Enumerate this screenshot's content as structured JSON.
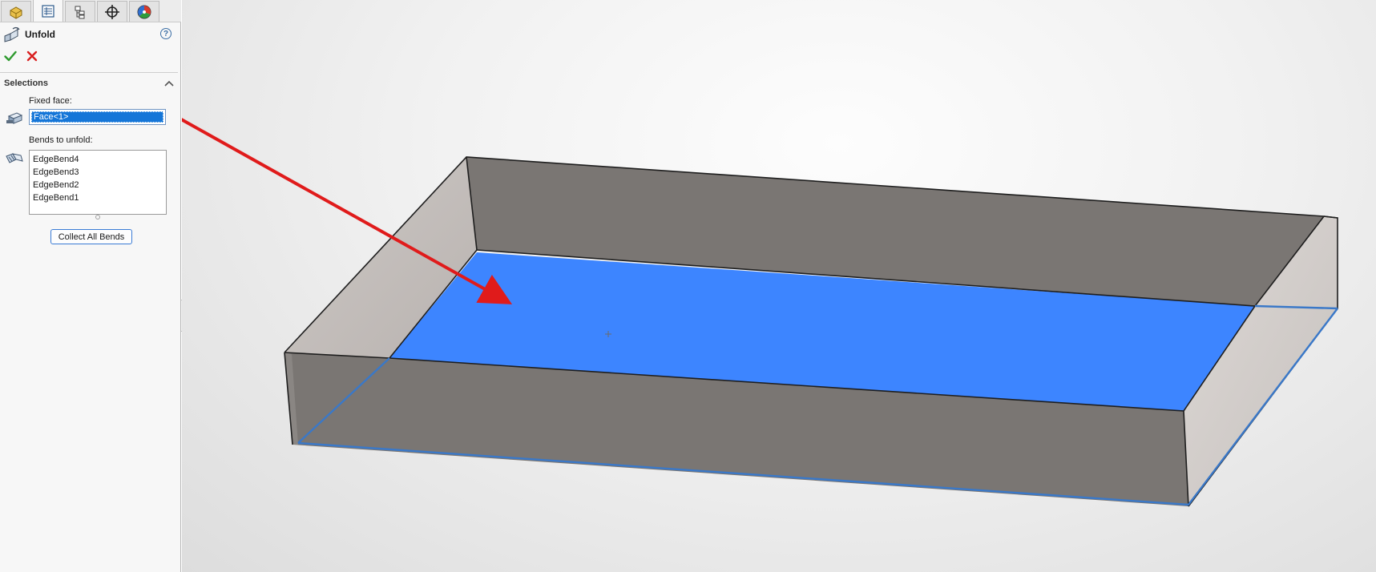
{
  "panel": {
    "tabs": [
      {
        "name": "featuremanager-tab",
        "icon": "part-icon"
      },
      {
        "name": "propertymanager-tab",
        "icon": "property-list-icon",
        "active": true
      },
      {
        "name": "configurationmanager-tab",
        "icon": "configuration-icon"
      },
      {
        "name": "dimxpertmanager-tab",
        "icon": "crosshair-icon"
      },
      {
        "name": "displaymanager-tab",
        "icon": "appearance-icon"
      }
    ],
    "title": "Unfold",
    "help_icon": "?",
    "section_title": "Selections",
    "fixed_face_label": "Fixed face:",
    "fixed_face_value": "Face<1>",
    "bends_label": "Bends to unfold:",
    "bends": [
      "EdgeBend4",
      "EdgeBend3",
      "EdgeBend2",
      "EdgeBend1"
    ],
    "collect_button": "Collect All Bends"
  },
  "colors": {
    "selection_blue": "#3d85ff",
    "annotation_arrow": "#e01b1b",
    "confirm_green": "#2e9a2e",
    "cancel_red": "#d91f1f",
    "wall_dark": "#7a7673",
    "wall_light": "#c4bfbc"
  }
}
